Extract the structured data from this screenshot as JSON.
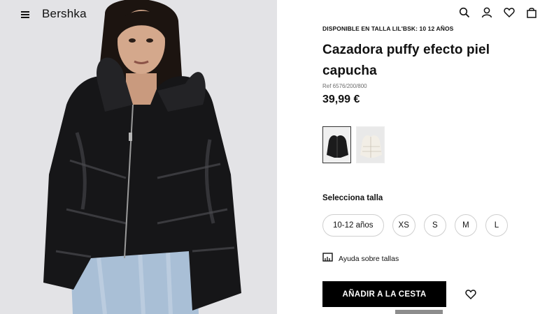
{
  "header": {
    "brand": "Bershka",
    "icons": [
      "menu-icon",
      "search-icon",
      "user-icon",
      "heart-icon",
      "bag-icon"
    ]
  },
  "product": {
    "availability": "DISPONIBLE EN TALLA LIL'BSK: 10 12 AÑOS",
    "title": "Cazadora puffy efecto piel capucha",
    "ref": "Ref 6576/200/800",
    "price": "39,99 €",
    "colors": [
      {
        "name": "black",
        "hex": "#1b1b1c",
        "selected": true
      },
      {
        "name": "cream",
        "hex": "#ece8e0",
        "selected": false
      }
    ]
  },
  "sizes": {
    "label": "Selecciona talla",
    "options": [
      "10-12 años",
      "XS",
      "S",
      "M",
      "L"
    ]
  },
  "size_help": {
    "label": "Ayuda sobre tallas"
  },
  "actions": {
    "add_to_cart": "AÑADIR A LA CESTA"
  }
}
